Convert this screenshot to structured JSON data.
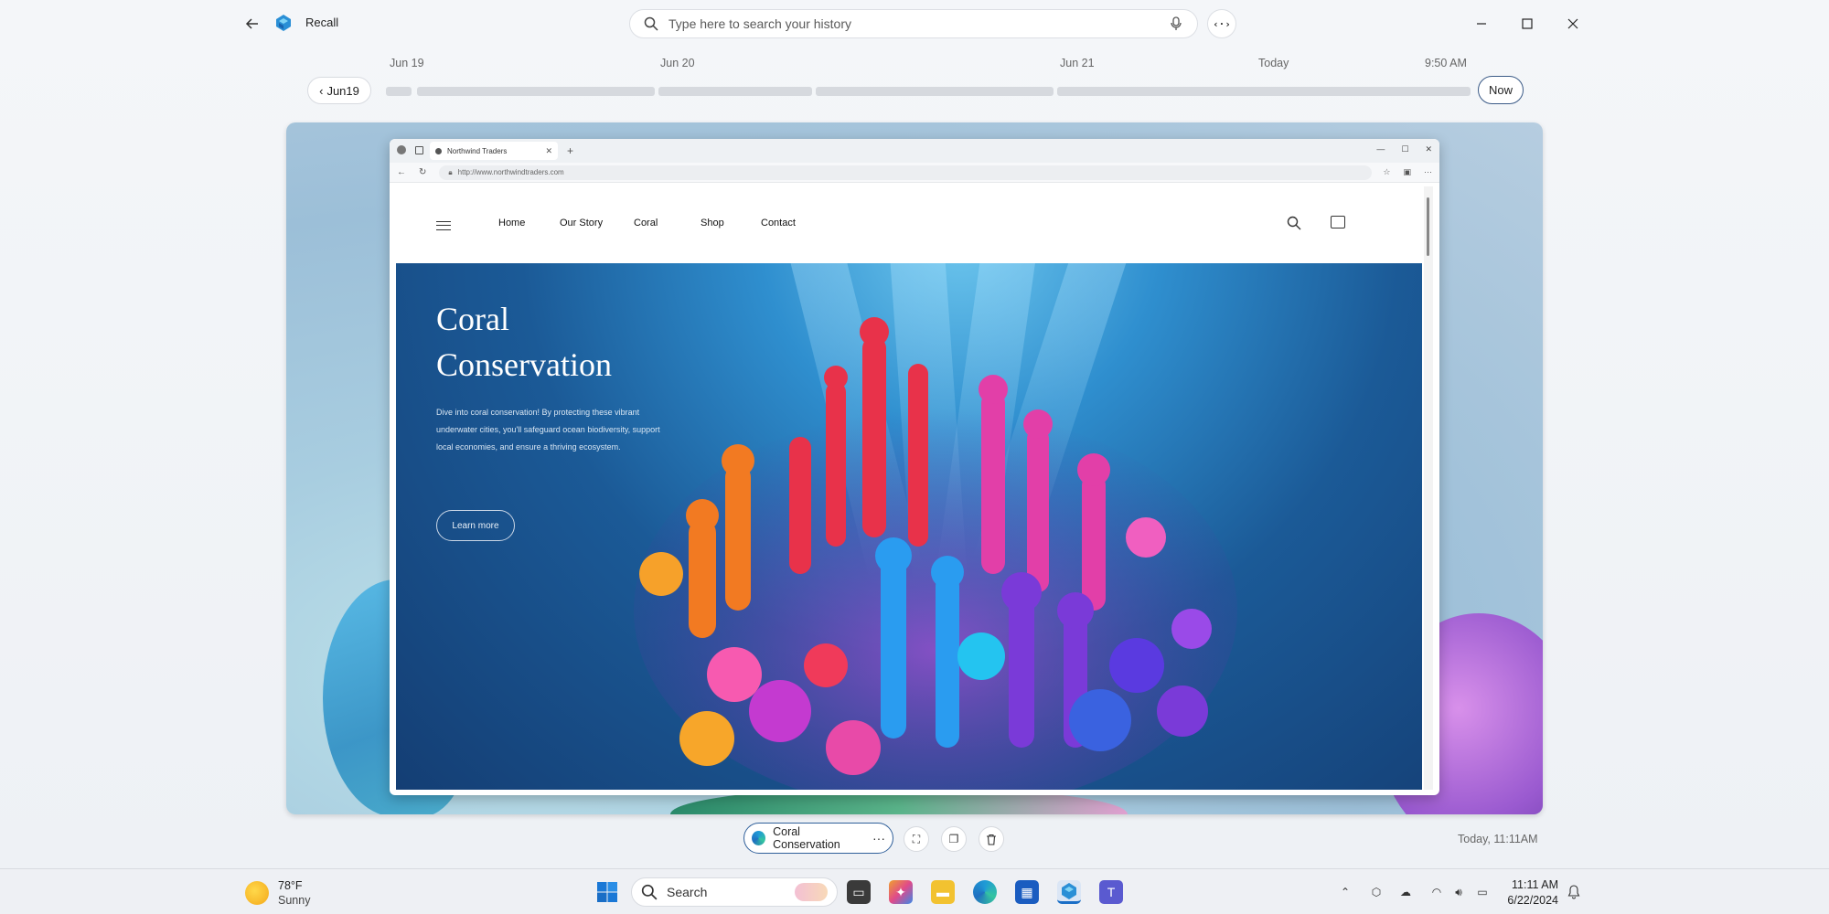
{
  "app": {
    "title": "Recall",
    "search_placeholder": "Type here to search your history"
  },
  "timeline": {
    "labels": [
      "Jun 19",
      "Jun 20",
      "Jun 21",
      "Today",
      "9:50 AM"
    ],
    "date_button": "Jun19",
    "now_button": "Now"
  },
  "snapshot": {
    "browser": {
      "tab_title": "Northwind Traders",
      "url": "http://www.northwindtraders.com"
    },
    "site": {
      "nav": [
        "Home",
        "Our Story",
        "Coral",
        "Shop",
        "Contact"
      ],
      "hero_title_line1": "Coral",
      "hero_title_line2": "Conservation",
      "hero_text": "Dive into coral conservation! By protecting these vibrant underwater cities, you'll safeguard ocean biodiversity, support local economies, and ensure a thriving ecosystem.",
      "hero_button": "Learn more"
    }
  },
  "bottom": {
    "chip_label": "Coral Conservation",
    "timestamp": "Today, 11:11AM"
  },
  "taskbar": {
    "weather_temp": "78°F",
    "weather_desc": "Sunny",
    "search_label": "Search",
    "clock_time": "11:11 AM",
    "clock_date": "6/22/2024"
  },
  "colors": {
    "accent": "#2f5f9a",
    "hero_deep": "#143e74",
    "hero_light": "#6ec7ee"
  }
}
